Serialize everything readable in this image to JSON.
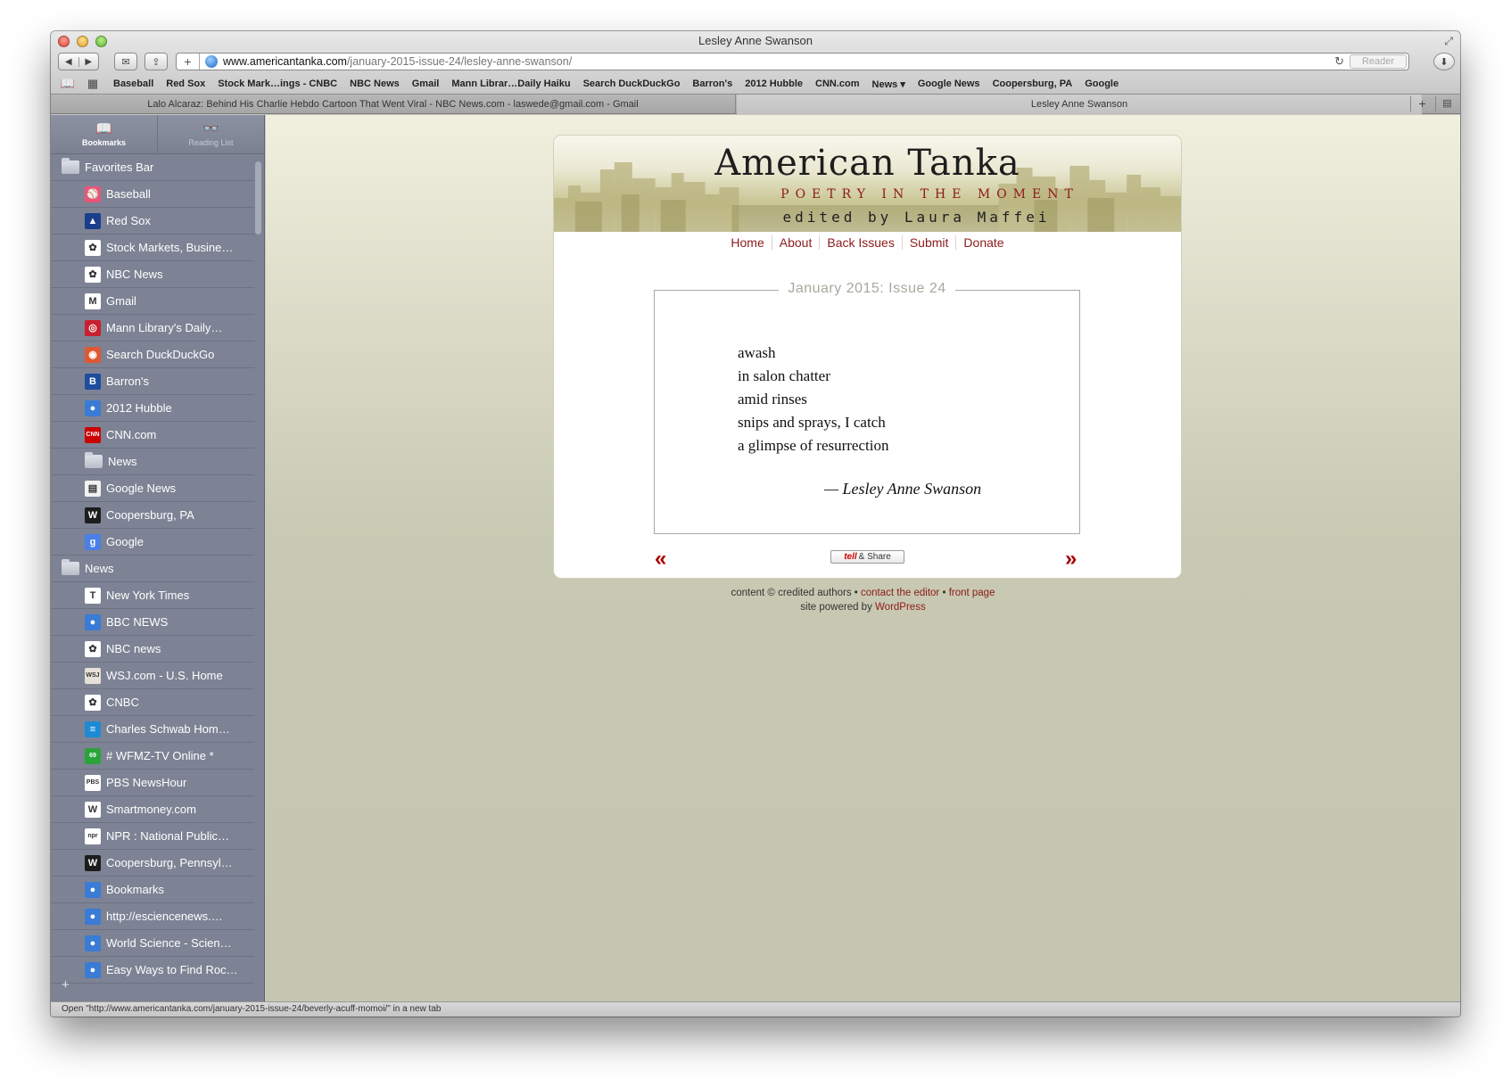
{
  "window": {
    "title": "Lesley Anne Swanson"
  },
  "toolbar": {
    "back_icon": "◀",
    "forward_icon": "▶",
    "mail_icon": "✉",
    "share_icon": "⇪",
    "new_tab_plus": "+",
    "url_host": "www.americantanka.com",
    "url_path": "/january-2015-issue-24/lesley-anne-swanson/",
    "reload_icon": "↻",
    "reader_label": "Reader",
    "download_icon": "⬇"
  },
  "bookmarks_bar": {
    "items": [
      "Baseball",
      "Red Sox",
      "Stock Mark…ings - CNBC",
      "NBC News",
      "Gmail",
      "Mann Librar…Daily Haiku",
      "Search DuckDuckGo",
      "Barron's",
      "2012 Hubble",
      "CNN.com",
      "News ▾",
      "Google News",
      "Coopersburg, PA",
      "Google"
    ]
  },
  "tabs": [
    {
      "label": "Lalo Alcaraz: Behind His Charlie Hebdo Cartoon That Went Viral - NBC News.com - laswede@gmail.com - Gmail"
    },
    {
      "label": "Lesley Anne Swanson"
    }
  ],
  "sidebar": {
    "toggle": {
      "bookmarks": "Bookmarks",
      "reading_list": "Reading List"
    },
    "items": [
      {
        "type": "folder",
        "label": "Favorites Bar"
      },
      {
        "type": "child",
        "label": "Baseball",
        "icon": "baseball-icon",
        "color": "#e8557a",
        "glyph": "⚾"
      },
      {
        "type": "child",
        "label": "Red Sox",
        "icon": "mlb-icon",
        "color": "#1b3e8c",
        "glyph": "▲"
      },
      {
        "type": "child",
        "label": "Stock Markets, Busine…",
        "icon": "nbc-peacock-icon",
        "color": "#ffffff",
        "glyph": "✿"
      },
      {
        "type": "child",
        "label": "NBC News",
        "icon": "nbc-peacock-icon",
        "color": "#ffffff",
        "glyph": "✿"
      },
      {
        "type": "child",
        "label": "Gmail",
        "icon": "gmail-icon",
        "color": "#ffffff",
        "glyph": "M"
      },
      {
        "type": "child",
        "label": "Mann Library's Daily…",
        "icon": "mann-library-icon",
        "color": "#c8202f",
        "glyph": "◎"
      },
      {
        "type": "child",
        "label": "Search DuckDuckGo",
        "icon": "duckduckgo-icon",
        "color": "#de5833",
        "glyph": "◉"
      },
      {
        "type": "child",
        "label": "Barron's",
        "icon": "barrons-icon",
        "color": "#1e4d9c",
        "glyph": "B"
      },
      {
        "type": "child",
        "label": "2012 Hubble",
        "icon": "globe-icon",
        "color": "#3a7bd5",
        "glyph": "●"
      },
      {
        "type": "child",
        "label": "CNN.com",
        "icon": "cnn-icon",
        "color": "#cc0000",
        "glyph": "CNN"
      },
      {
        "type": "child",
        "label": "News",
        "icon": "folder-icon",
        "color": "#dfe2e9",
        "glyph": ""
      },
      {
        "type": "child",
        "label": "Google News",
        "icon": "google-news-icon",
        "color": "#f1f1f1",
        "glyph": "▤"
      },
      {
        "type": "child",
        "label": "Coopersburg, PA",
        "icon": "weather-icon",
        "color": "#1d1d1d",
        "glyph": "W"
      },
      {
        "type": "child",
        "label": "Google",
        "icon": "google-icon",
        "color": "#4a7fe6",
        "glyph": "g"
      },
      {
        "type": "folder",
        "label": "News"
      },
      {
        "type": "child",
        "label": "New York Times",
        "icon": "nyt-icon",
        "color": "#ffffff",
        "glyph": "T"
      },
      {
        "type": "child",
        "label": "BBC NEWS",
        "icon": "globe-icon",
        "color": "#3a7bd5",
        "glyph": "●"
      },
      {
        "type": "child",
        "label": "NBC news",
        "icon": "nbc-peacock-icon",
        "color": "#ffffff",
        "glyph": "✿"
      },
      {
        "type": "child",
        "label": "WSJ.com - U.S. Home",
        "icon": "wsj-icon",
        "color": "#e6e1d6",
        "glyph": "WSJ"
      },
      {
        "type": "child",
        "label": "CNBC",
        "icon": "nbc-peacock-icon",
        "color": "#ffffff",
        "glyph": "✿"
      },
      {
        "type": "child",
        "label": "Charles Schwab Hom…",
        "icon": "schwab-icon",
        "color": "#1e8ad6",
        "glyph": "≡"
      },
      {
        "type": "child",
        "label": "# WFMZ-TV Online *",
        "icon": "wfmz-icon",
        "color": "#2aa33b",
        "glyph": "69"
      },
      {
        "type": "child",
        "label": "PBS NewsHour",
        "icon": "pbs-icon",
        "color": "#ffffff",
        "glyph": "PBS"
      },
      {
        "type": "child",
        "label": "Smartmoney.com",
        "icon": "smartmoney-icon",
        "color": "#ffffff",
        "glyph": "W"
      },
      {
        "type": "child",
        "label": "NPR : National Public…",
        "icon": "npr-icon",
        "color": "#ffffff",
        "glyph": "npr"
      },
      {
        "type": "child",
        "label": "Coopersburg, Pennsyl…",
        "icon": "weather-icon",
        "color": "#1d1d1d",
        "glyph": "W"
      },
      {
        "type": "child",
        "label": "Bookmarks",
        "icon": "globe-icon",
        "color": "#3a7bd5",
        "glyph": "●"
      },
      {
        "type": "child",
        "label": "http://esciencenews.…",
        "icon": "globe-icon",
        "color": "#3a7bd5",
        "glyph": "●"
      },
      {
        "type": "child",
        "label": "World Science - Scien…",
        "icon": "globe-icon",
        "color": "#3a7bd5",
        "glyph": "●"
      },
      {
        "type": "child",
        "label": "Easy Ways to Find Roc…",
        "icon": "globe-icon",
        "color": "#3a7bd5",
        "glyph": "●"
      }
    ],
    "add_label": "+"
  },
  "page": {
    "site_title": "American Tanka",
    "site_subtitle": "POETRY IN THE MOMENT",
    "site_editor": "edited by Laura Maffei",
    "nav": [
      "Home",
      "About",
      "Back Issues",
      "Submit",
      "Donate"
    ],
    "issue_title": "January 2015: Issue 24",
    "poem_lines": [
      "awash",
      "in salon chatter",
      "amid rinses",
      "snips and sprays, I catch",
      "a glimpse of resurrection"
    ],
    "byline": "—  Lesley Anne Swanson",
    "prev_arrow": "«",
    "next_arrow": "»",
    "tell_share": {
      "brand": "tell",
      "label": "& Share"
    },
    "footer": {
      "credit": "content © credited authors",
      "bullet": "•",
      "contact": "contact the editor",
      "front_page": "front page",
      "powered_by": "site powered by",
      "wordpress": "WordPress"
    }
  },
  "status_bar": {
    "text": "Open \"http://www.americantanka.com/january-2015-issue-24/beverly-acuff-momoi/\" in a new tab"
  },
  "colors": {
    "accent_red": "#8b1a1a",
    "sidebar_bg": "#7d8394",
    "page_bg": "#c5c6b0"
  }
}
